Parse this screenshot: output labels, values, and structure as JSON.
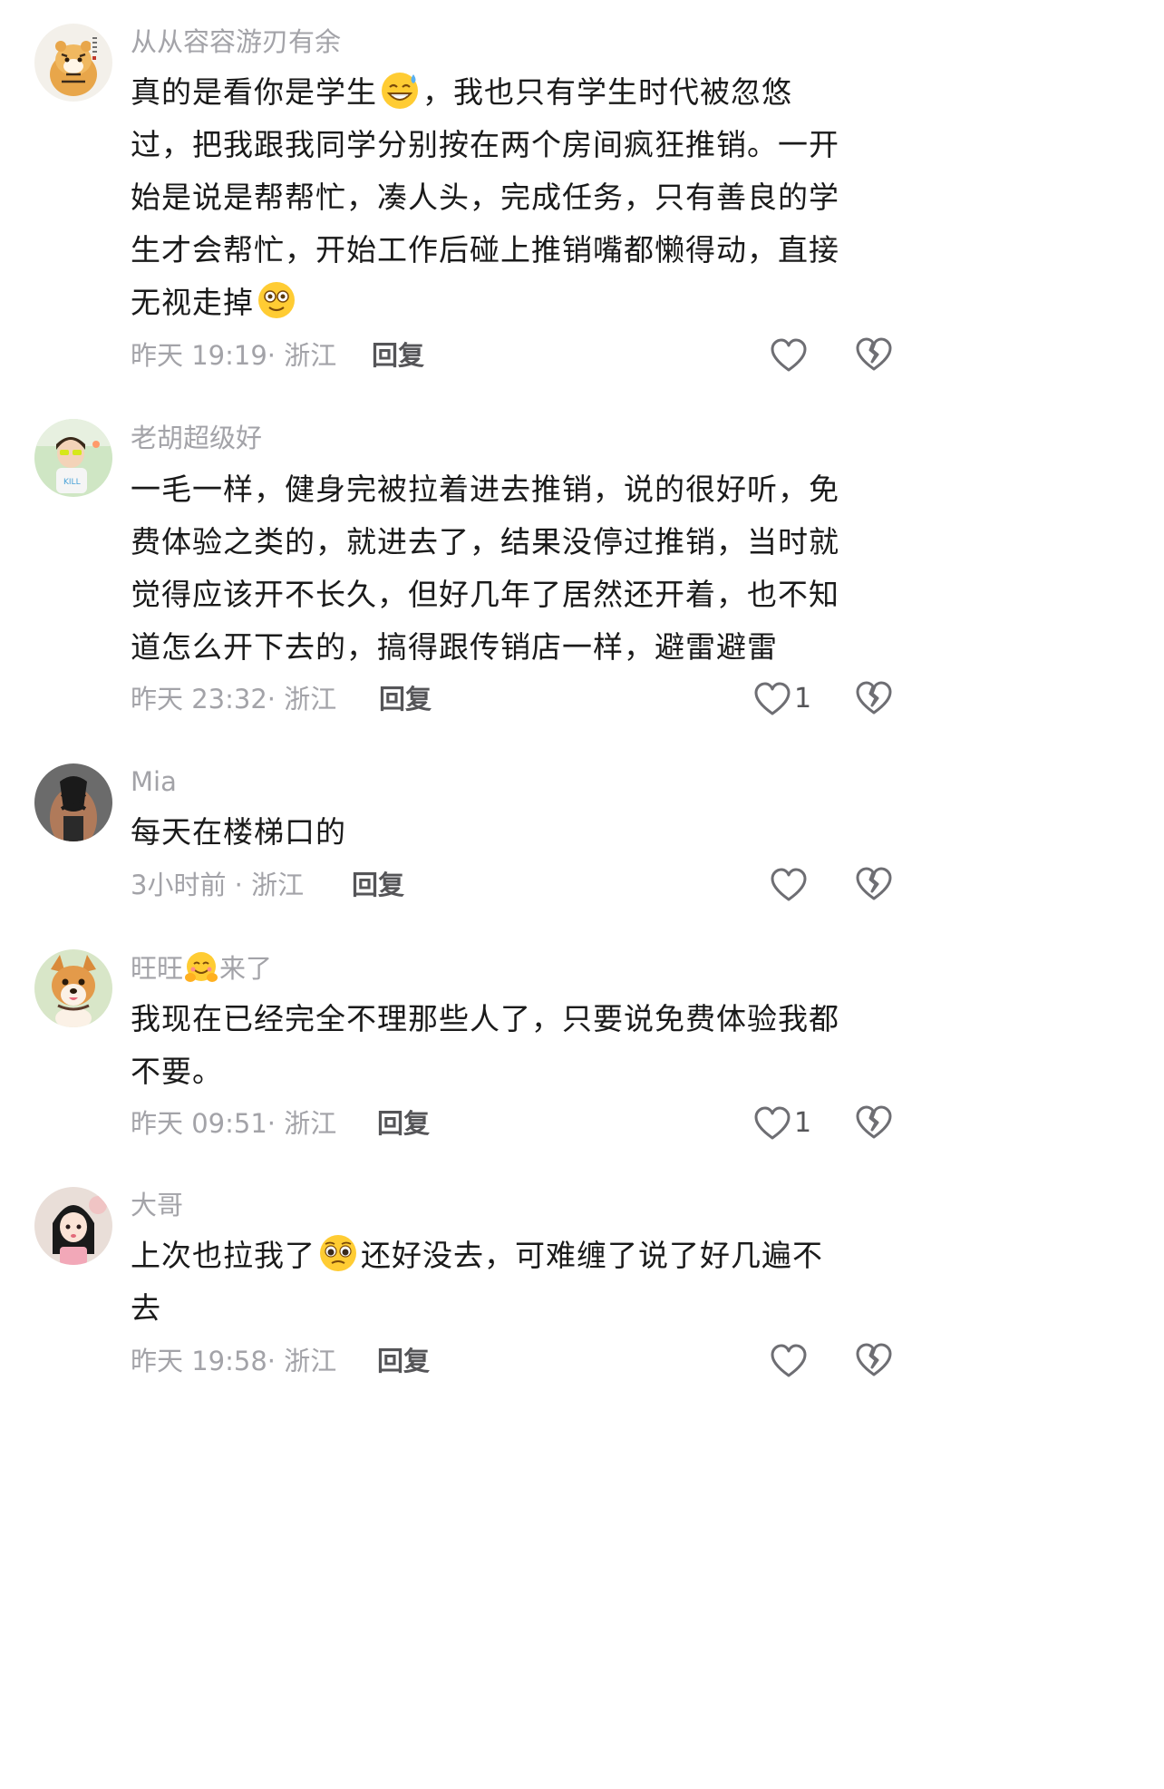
{
  "comments": [
    {
      "username": "从从容容游刃有余",
      "lines": [
        {
          "before": "真的是看你是学生",
          "emoji": "grinning-sweat-emoji",
          "after": "，我也只有学生时代被忽悠"
        },
        {
          "text": "过，把我跟我同学分别按在两个房间疯狂推销。一开"
        },
        {
          "text": "始是说是帮帮忙，凑人头，完成任务，只有善良的学"
        },
        {
          "text": "生才会帮忙，开始工作后碰上推销嘴都懒得动，直接"
        },
        {
          "before": "无视走掉",
          "emoji": "dizzy-face-emoji",
          "after": ""
        }
      ],
      "time": "昨天 19:19",
      "location": "· 浙江",
      "reply_label": "回复",
      "like_count": "",
      "avatar": "tiger-avatar"
    },
    {
      "username": "老胡超级好",
      "lines": [
        {
          "text": "一毛一样，健身完被拉着进去推销，说的很好听，免"
        },
        {
          "text": "费体验之类的，就进去了，结果没停过推销，当时就"
        },
        {
          "text": "觉得应该开不长久，但好几年了居然还开着，也不知"
        },
        {
          "text": "道怎么开下去的，搞得跟传销店一样，避雷避雷"
        }
      ],
      "time": "昨天 23:32",
      "location": "· 浙江",
      "reply_label": "回复",
      "like_count": "1",
      "avatar": "kid-sunglasses-avatar"
    },
    {
      "username": "Mia",
      "lines": [
        {
          "text": "每天在楼梯口的"
        }
      ],
      "time": "3小时前",
      "location": " · 浙江",
      "reply_label": "回复",
      "like_count": "",
      "avatar": "woman-back-avatar"
    },
    {
      "username_before": "旺旺",
      "username_emoji": "hugging-face-emoji",
      "username_after": "来了",
      "lines": [
        {
          "text": "我现在已经完全不理那些人了，只要说免费体验我都"
        },
        {
          "text": "不要。"
        }
      ],
      "time": "昨天 09:51",
      "location": "· 浙江",
      "reply_label": "回复",
      "like_count": "1",
      "avatar": "corgi-dog-avatar"
    },
    {
      "username": "大哥",
      "lines": [
        {
          "before": "上次也拉我了",
          "emoji": "pleading-face-emoji",
          "after": "还好没去，可难缠了说了好几遍不"
        },
        {
          "text": "去"
        }
      ],
      "time": "昨天 19:58",
      "location": "· 浙江",
      "reply_label": "回复",
      "like_count": "",
      "avatar": "girl-cartoon-avatar"
    }
  ],
  "colors": {
    "text": "#1a1a1a",
    "muted": "#a3a3a8",
    "reply": "#555558",
    "icon": "#6e6e73"
  }
}
